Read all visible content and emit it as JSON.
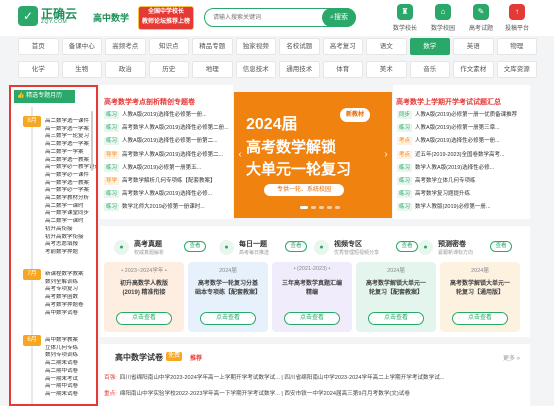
{
  "header": {
    "logo_cn": "正确云",
    "logo_en": "ZQY.COM",
    "site_sub": "高中数学",
    "promo_line1": "全国中学校长",
    "promo_line2": "教师论坛推荐上榜",
    "search_placeholder": "请输入搜索关键词",
    "search_button": "搜索",
    "quick_links": [
      {
        "label": "数学校长",
        "icon": "school-icon"
      },
      {
        "label": "数学校园",
        "icon": "campus-icon"
      },
      {
        "label": "高考试题",
        "icon": "exam-icon"
      },
      {
        "label": "投稿平台",
        "icon": "upload-icon"
      }
    ]
  },
  "subjects_row1": [
    "首页",
    "备课中心",
    "高频考点",
    "知识点",
    "精品专题",
    "独家视频",
    "名校试题",
    "高考复习",
    "语文",
    "数学",
    "英语",
    "物理"
  ],
  "subjects_row2": [
    "化学",
    "生物",
    "政治",
    "历史",
    "地理",
    "信息技术",
    "通用技术",
    "体育",
    "美术",
    "音乐",
    "作文素材",
    "文库资源"
  ],
  "active_subject": "数学",
  "left_panel": {
    "title": "精选专题月历",
    "months": [
      {
        "label": "8月",
        "items": [
          "高二数学选一课件",
          "高一数学选一学案",
          "高三数学一轮复习",
          "高二数学选一学案",
          "高二数学一学案",
          "高二数学选一教案",
          "高一数学必一教学设计",
          "高一数学必一课件",
          "高一数学选一教案",
          "高一数学必一学案",
          "高二数学教材分析",
          "高二数学一课时",
          "高一数学课堂同步",
          "高二数学一课时",
          "初升高衔接",
          "初升高数学衔接",
          "高考志愿填报",
          "考前数学押题"
        ]
      },
      {
        "label": "7月",
        "items": [
          "新课程数学教案",
          "数列全解训练",
          "高考专项复习",
          "高考数学函数",
          "高考数学押题卷",
          "高中数学试卷"
        ]
      },
      {
        "label": "6月",
        "items": [
          "高中数学教案",
          "立体几何专练",
          "数列专项训练",
          "高二期末试卷",
          "高二期中试卷",
          "高一期末考试",
          "高一期中试卷",
          "高一期末试卷"
        ]
      }
    ]
  },
  "section1": {
    "title": "高考数学考点剖析精创专题卷",
    "rows": [
      {
        "tag": "练习",
        "text": "人教A版(2019)选择性必修第一册..."
      },
      {
        "tag": "练习",
        "text": "高考数学人教A版(2019)选择性必修第二册..."
      },
      {
        "tag": "练习",
        "text": "人教A版(2019)选择性必修第一册第二..."
      },
      {
        "tag": "导学",
        "text": "高考数学人教A版(2019)选择性必修第二..."
      },
      {
        "tag": "练习",
        "text": "人教A版(2019)必修第一册第五..."
      },
      {
        "tag": "导学",
        "text": "高考数学解析几何专项练【配套教案】"
      },
      {
        "tag": "练习",
        "text": "高考数学人教A版(2019)选择性必修..."
      },
      {
        "tag": "练习",
        "text": "数学北师大2019必修第一册课时..."
      }
    ]
  },
  "banner": {
    "badge": "新教材",
    "line1": "2024届",
    "line2": "高考数学解锁",
    "line3": "大单元一轮复习",
    "pill": "专供一轮、系统校园"
  },
  "section2": {
    "title": "高考数学上学期开学考试试题汇总",
    "rows": [
      {
        "tag": "同步",
        "text": "人教A版(2019)必修第一册一优质备课推荐"
      },
      {
        "tag": "练习",
        "text": "人教A版(2019)必修第一册第三章..."
      },
      {
        "tag": "考点",
        "text": "人教A版(2019)选择性必修第一册..."
      },
      {
        "tag": "考点",
        "text": "近五年(2019-2023)全国卷数学高考..."
      },
      {
        "tag": "练习",
        "text": "数学人教A版(2019)选择性必修..."
      },
      {
        "tag": "练习",
        "text": "高考数学立体几何专项练"
      },
      {
        "tag": "练习",
        "text": "高考数学复习题提升练"
      },
      {
        "tag": "练习",
        "text": "数学人教版(2019)必修第一册..."
      }
    ]
  },
  "categories": [
    {
      "title": "高考真题",
      "sub": "权威真题解析",
      "button": "查看",
      "icon": "book-icon"
    },
    {
      "title": "每日一题",
      "sub": "高考每日推送",
      "button": "查看",
      "icon": "calendar-icon"
    },
    {
      "title": "视频专区",
      "sub": "优秀管理短视频分享",
      "button": "查看",
      "icon": "video-icon"
    },
    {
      "title": "预测密卷",
      "sub": "紧跟新课标方向",
      "button": "查看",
      "icon": "forecast-icon"
    }
  ],
  "cards": [
    {
      "top": "• 2023~2024学年 •",
      "lines": [
        "初升高数学人教版",
        "(2019) 精准衔接"
      ],
      "button": "点击查看",
      "bg": "#fdeee1"
    },
    {
      "top": "2024届",
      "lines": [
        "高考数学一轮复习分基",
        "础本专项练【配套教案】"
      ],
      "button": "点击查看",
      "bg": "#e7f1fb"
    },
    {
      "top": "• (2021-2023) •",
      "lines": [
        "三年高考数学真题汇编",
        "精编"
      ],
      "button": "点击查看",
      "bg": "#f0ecfb"
    },
    {
      "top": "2024届",
      "lines": [
        "高考数学解锁大单元一",
        "轮复习【配套教案】"
      ],
      "button": "点击查看",
      "bg": "#e3f5ec"
    },
    {
      "top": "2024届",
      "lines": [
        "高考数学解锁大单元一",
        "轮复习【通用版】"
      ],
      "button": "点击查看",
      "bg": "#fdf1e0"
    }
  ],
  "bottom": {
    "title": "高中数学试卷",
    "badge": "免费",
    "rec": "推荐",
    "more": "更多 »",
    "rows": [
      {
        "tag": "百强:",
        "text": "四川省绵阳南山中学2023-2024学年高一上学期开学考试数学试... | 四川省绵阳南山中学2023-2024学年高二上学期开学考试数学试..."
      },
      {
        "tag": "重点:",
        "text": "绵阳南山中学实验学校2022-2023学年高一下学期开学考试数学... | 西安市铁一中学2024届高三第9月月考数学(文)试卷"
      }
    ]
  }
}
